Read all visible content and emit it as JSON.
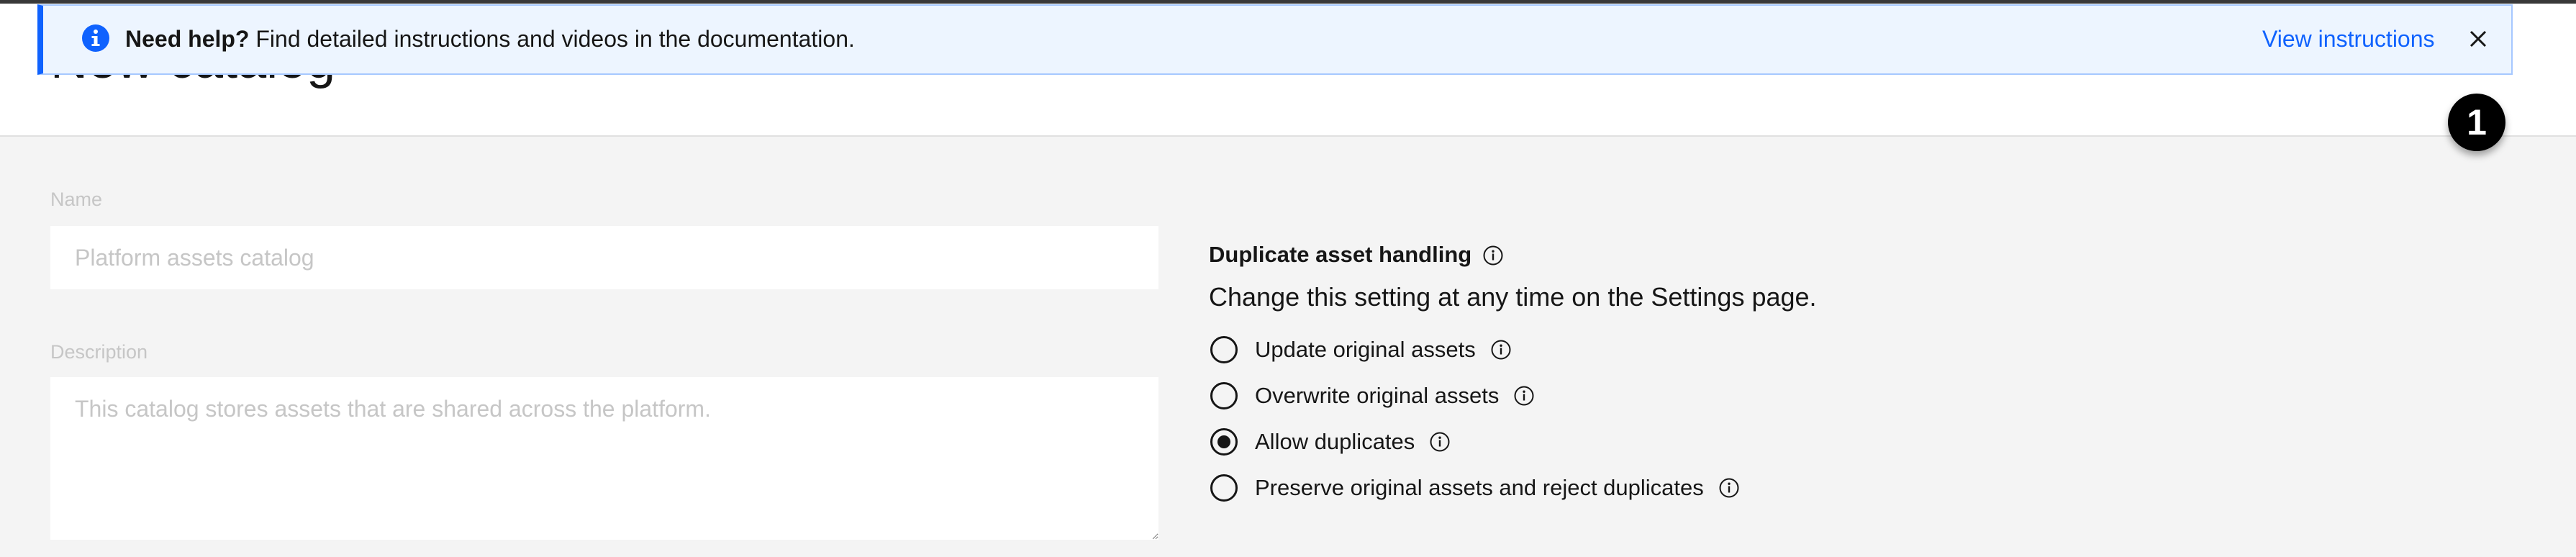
{
  "header": {
    "title": "New catalog"
  },
  "notification": {
    "lead": "Need help?",
    "message": " Find detailed instructions and videos in the documentation.",
    "link_label": "View instructions",
    "icon": "info-icon",
    "close_icon": "close-icon",
    "accent_color": "#0f62fe",
    "background_color": "#edf5ff"
  },
  "step_badge": {
    "number": "1"
  },
  "form": {
    "name": {
      "label": "Name",
      "placeholder": "Platform assets catalog",
      "value": ""
    },
    "description": {
      "label": "Description",
      "placeholder": "This catalog stores assets that are shared across the platform.",
      "value": ""
    }
  },
  "duplicates": {
    "title": "Duplicate asset handling",
    "subtitle": "Change this setting at any time on the Settings page.",
    "options": [
      {
        "label": "Update original assets",
        "checked": false
      },
      {
        "label": "Overwrite original assets",
        "checked": false
      },
      {
        "label": "Allow duplicates",
        "checked": true
      },
      {
        "label": "Preserve original assets and reject duplicates",
        "checked": false
      }
    ]
  }
}
